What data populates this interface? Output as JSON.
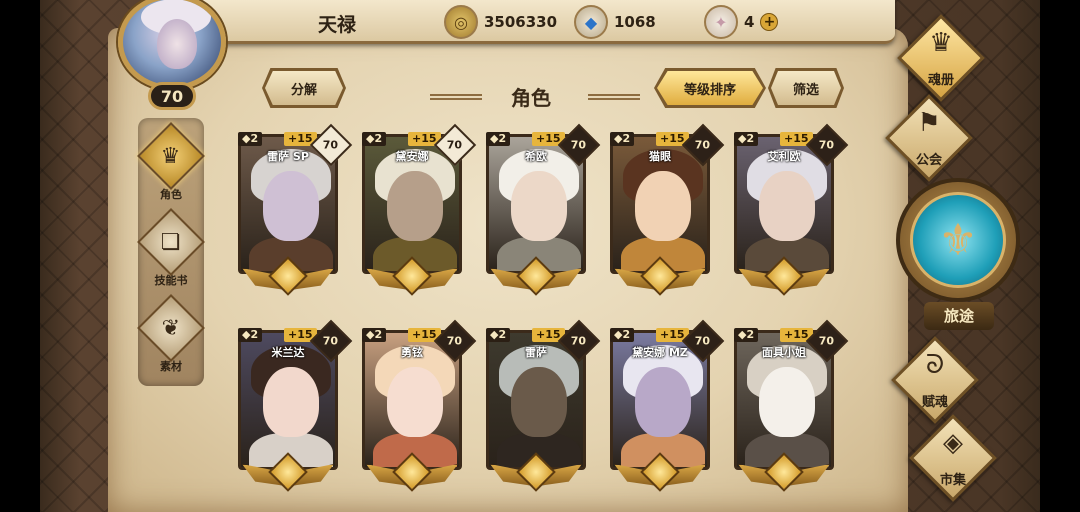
{
  "player": {
    "name": "天禄",
    "level": "70"
  },
  "resources": {
    "gold": "3506330",
    "crystal": "1068",
    "gem": "4",
    "gem_plus": "+"
  },
  "side_tabs": [
    {
      "label": "角色",
      "icon": "helmet-icon",
      "active": true
    },
    {
      "label": "技能书",
      "icon": "book-icon",
      "active": false
    },
    {
      "label": "素材",
      "icon": "beast-icon",
      "active": false
    }
  ],
  "header": {
    "title": "角色",
    "decompose_label": "分解",
    "sort_label": "等级排序",
    "filter_label": "筛选"
  },
  "cards": [
    {
      "name": "雷萨 SP",
      "stars": "2",
      "plus": "+15",
      "level": "70",
      "level_dark": false,
      "palette": {
        "bg": "#6e5a4a",
        "hair": "#d7d3d0",
        "skin": "#cfc0d4",
        "cloth": "#5a3e2c"
      }
    },
    {
      "name": "黛安娜",
      "stars": "2",
      "plus": "+15",
      "level": "70",
      "level_dark": false,
      "palette": {
        "bg": "#5b5a3a",
        "hair": "#e8e2d0",
        "skin": "#b69f8a",
        "cloth": "#6c5a2a"
      }
    },
    {
      "name": "希欧",
      "stars": "2",
      "plus": "+15",
      "level": "70",
      "level_dark": true,
      "palette": {
        "bg": "#aaa49a",
        "hair": "#f2efe8",
        "skin": "#ecd8c8",
        "cloth": "#8a8578"
      }
    },
    {
      "name": "猫眼",
      "stars": "2",
      "plus": "+15",
      "level": "70",
      "level_dark": true,
      "palette": {
        "bg": "#7a5a3a",
        "hair": "#5a3420",
        "skin": "#f1d2b4",
        "cloth": "#c0863a"
      }
    },
    {
      "name": "艾利欧",
      "stars": "2",
      "plus": "+15",
      "level": "70",
      "level_dark": true,
      "palette": {
        "bg": "#6a6270",
        "hair": "#e0dde4",
        "skin": "#e8d2c4",
        "cloth": "#5a4a3a"
      }
    },
    {
      "name": "米兰达",
      "stars": "2",
      "plus": "+15",
      "level": "70",
      "level_dark": true,
      "palette": {
        "bg": "#4e4a60",
        "hair": "#3a2820",
        "skin": "#f2d8cc",
        "cloth": "#d8d0c8"
      }
    },
    {
      "name": "勇铉",
      "stars": "2",
      "plus": "+15",
      "level": "70",
      "level_dark": true,
      "palette": {
        "bg": "#c8a080",
        "hair": "#f4d8b8",
        "skin": "#f6ddd0",
        "cloth": "#c06a4a"
      }
    },
    {
      "name": "雷萨",
      "stars": "2",
      "plus": "+15",
      "level": "70",
      "level_dark": true,
      "palette": {
        "bg": "#3e3a2e",
        "hair": "#b8bcb8",
        "skin": "#6a5a4a",
        "cloth": "#2e2620"
      }
    },
    {
      "name": "黛安娜 MZ",
      "stars": "2",
      "plus": "+15",
      "level": "70",
      "level_dark": true,
      "palette": {
        "bg": "#7a7aa0",
        "hair": "#e8e6f0",
        "skin": "#b8a8c8",
        "cloth": "#d09060"
      }
    },
    {
      "name": "面具小姐",
      "stars": "2",
      "plus": "+15",
      "level": "70",
      "level_dark": true,
      "palette": {
        "bg": "#6e665c",
        "hair": "#d8d0c4",
        "skin": "#f4f0ea",
        "cloth": "#5a5048"
      }
    }
  ],
  "right_menu": [
    {
      "label": "魂册",
      "icon": "helmet-icon",
      "active": true
    },
    {
      "label": "公会",
      "icon": "bird-banner-icon",
      "active": false
    },
    {
      "label": "旅途",
      "icon": "trident-emblem-icon",
      "active": false
    },
    {
      "label": "赋魂",
      "icon": "flame-swirl-icon",
      "active": false
    },
    {
      "label": "市集",
      "icon": "diamond-icon",
      "active": false
    }
  ],
  "icons": {
    "gold": "coin-icon",
    "crystal": "crystal-icon",
    "gem": "gem-icon"
  }
}
